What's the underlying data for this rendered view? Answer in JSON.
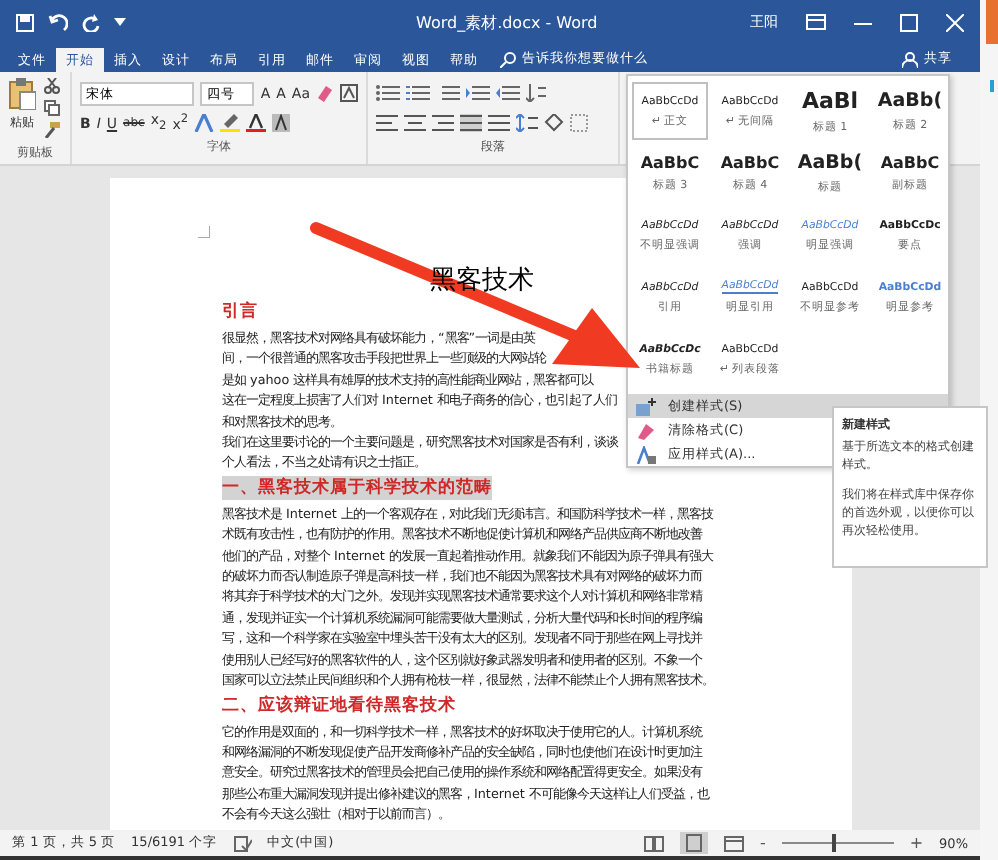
{
  "window": {
    "title": "Word_素材.docx  -  Word",
    "user": "王阳"
  },
  "tabs": [
    {
      "label": "文件",
      "selected": false
    },
    {
      "label": "开始",
      "selected": true
    },
    {
      "label": "插入",
      "selected": false
    },
    {
      "label": "设计",
      "selected": false
    },
    {
      "label": "布局",
      "selected": false
    },
    {
      "label": "引用",
      "selected": false
    },
    {
      "label": "邮件",
      "selected": false
    },
    {
      "label": "审阅",
      "selected": false
    },
    {
      "label": "视图",
      "selected": false
    },
    {
      "label": "帮助",
      "selected": false
    }
  ],
  "tell_me": {
    "placeholder": "告诉我你想要做什么"
  },
  "share": "共享",
  "ribbon": {
    "clipboard": {
      "paste": "粘贴",
      "label": "剪贴板"
    },
    "font": {
      "name": "宋体",
      "size": "四号",
      "label": "字体",
      "sizers": [
        "A",
        "A",
        "Aa"
      ],
      "buttons": [
        "B",
        "I",
        "U",
        "abc",
        "x$_{2}$",
        "x$^{2}$"
      ]
    },
    "paragraph": {
      "label": "段落"
    }
  },
  "document": {
    "title": "黑客技术",
    "blocks": [
      {
        "kind": "heading",
        "text": "引言",
        "selected": false
      },
      {
        "kind": "para",
        "lines": [
          "很显然，黑客技术对网络具有破坏能力，“黑客”一词是由英",
          "间，一个很普通的黑客攻击手段把世界上一些顶级的大网站轮",
          "是如 yahoo 这样具有雄厚的技术支持的高性能商业网站，黑客都可以",
          "这在一定程度上损害了人们对 Internet 和电子商务的信心，也引起了人们",
          "和对黑客技术的思考。",
          "我们在这里要讨论的一个主要问题是，研究黑客技术对国家是否有利，谈谈",
          "个人看法，不当之处请有识之士指正。"
        ]
      },
      {
        "kind": "heading",
        "text": "一、黑客技术属于科学技术的范畴",
        "selected": true
      },
      {
        "kind": "para",
        "lines": [
          "黑客技术是 Internet 上的一个客观存在，对此我们无须讳言。和国防科学技术一样，黑客技",
          "术既有攻击性，也有防护的作用。黑客技术不断地促使计算机和网络产品供应商不断地改善",
          "他们的产品，对整个 Internet 的发展一直起着推动作用。就象我们不能因为原子弹具有强大",
          "的破坏力而否认制造原子弹是高科技一样，我们也不能因为黑客技术具有对网络的破坏力而",
          "将其弃于科学技术的大门之外。发现并实现黑客技术通常要求这个人对计算机和网络非常精",
          "通，发现并证实一个计算机系统漏洞可能需要做大量测试，分析大量代码和长时间的程序编",
          "写，这和一个科学家在实验室中埋头苦干没有太大的区别。发现者不同于那些在网上寻找并",
          "使用别人已经写好的黑客软件的人，这个区别就好象武器发明者和使用者的区别。不象一个",
          "国家可以立法禁止民间组织和个人拥有枪枝一样，很显然，法律不能禁止个人拥有黑客技术。"
        ]
      },
      {
        "kind": "heading",
        "text": "二、应该辩证地看待黑客技术",
        "selected": false
      },
      {
        "kind": "para",
        "lines": [
          "它的作用是双面的，和一切科学技术一样，黑客技术的好坏取决于使用它的人。计算机系统",
          "和网络漏洞的不断发现促使产品开发商修补产品的安全缺陷，同时也使他们在设计时更加注",
          "意安全。研究过黑客技术的管理员会把自己使用的操作系统和网络配置得更安全。如果没有",
          "那些公布重大漏洞发现并提出修补建议的黑客，Internet 不可能像今天这样让人们受益，也",
          "不会有今天这么强壮（相对于以前而言）。"
        ]
      }
    ]
  },
  "style_gallery": {
    "styles": [
      {
        "preview": "AaBbCcDd",
        "name": "↵ 正文",
        "kind": "normal",
        "selected": true
      },
      {
        "preview": "AaBbCcDd",
        "name": "↵ 无间隔",
        "kind": "normal",
        "selected": false
      },
      {
        "preview": "AaBl",
        "name": "标题 1",
        "kind": "h1",
        "selected": false
      },
      {
        "preview": "AaBb(",
        "name": "标题 2",
        "kind": "h2",
        "selected": false
      },
      {
        "preview": "AaBbC",
        "name": "标题 3",
        "kind": "h3",
        "selected": false
      },
      {
        "preview": "AaBbC",
        "name": "标题 4",
        "kind": "h3",
        "selected": false
      },
      {
        "preview": "AaBb(",
        "name": "标题",
        "kind": "h2",
        "selected": false
      },
      {
        "preview": "AaBbC",
        "name": "副标题",
        "kind": "h3",
        "selected": false
      },
      {
        "preview": "AaBbCcDd",
        "name": "不明显强调",
        "kind": "italic",
        "selected": false
      },
      {
        "preview": "AaBbCcDd",
        "name": "强调",
        "kind": "italic",
        "selected": false
      },
      {
        "preview": "AaBbCcDd",
        "name": "明显强调",
        "kind": "blueitalic",
        "selected": false
      },
      {
        "preview": "AaBbCcDc",
        "name": "要点",
        "kind": "bold",
        "selected": false
      },
      {
        "preview": "AaBbCcDd",
        "name": "引用",
        "kind": "italic",
        "selected": false
      },
      {
        "preview": "AaBbCcDd",
        "name": "明显引用",
        "kind": "quote",
        "selected": false
      },
      {
        "preview": "AaBbCcDd",
        "name": "不明显参考",
        "kind": "normal",
        "selected": false
      },
      {
        "preview": "AaBbCcDd",
        "name": "明显参考",
        "kind": "blue",
        "selected": false
      },
      {
        "preview": "AaBbCcDc",
        "name": "书籍标题",
        "kind": "bolditalic",
        "selected": false
      },
      {
        "preview": "AaBbCcDd",
        "name": "↵ 列表段落",
        "kind": "normal",
        "selected": false
      }
    ]
  },
  "menu": [
    {
      "label": "创建样式(S)",
      "kind": "create",
      "selected": true
    },
    {
      "label": "清除格式(C)",
      "kind": "clear",
      "selected": false
    },
    {
      "label": "应用样式(A)...",
      "kind": "apply",
      "selected": false
    }
  ],
  "tooltip": {
    "title": "新建样式",
    "paragraphs": [
      "基于所选文本的格式创建样式。",
      "我们将在样式库中保存你的首选外观，以便你可以再次轻松使用。"
    ]
  },
  "status_bar": {
    "page": "第 1 页，共 5 页",
    "words": "15/6191 个字",
    "language": "中文(中国)",
    "zoom": {
      "label": "90%",
      "level": 0.47,
      "minus": "-",
      "plus": "+"
    }
  }
}
